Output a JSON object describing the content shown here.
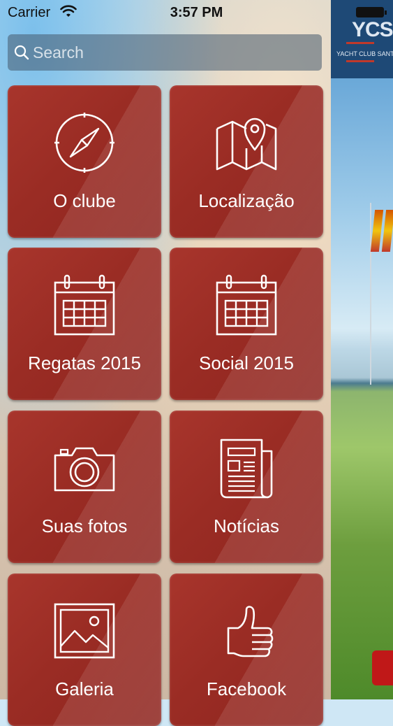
{
  "status_bar": {
    "carrier": "Carrier",
    "time": "3:57 PM"
  },
  "search": {
    "placeholder": "Search"
  },
  "side_panel": {
    "logo_text": "YCS",
    "logo_subtitle": "YACHT CLUB SANT"
  },
  "menu": {
    "items": [
      {
        "label": "O clube",
        "icon": "compass-icon"
      },
      {
        "label": "Localização",
        "icon": "map-pin-icon"
      },
      {
        "label": "Regatas 2015",
        "icon": "calendar-icon"
      },
      {
        "label": "Social 2015",
        "icon": "calendar-icon"
      },
      {
        "label": "Suas fotos",
        "icon": "camera-icon"
      },
      {
        "label": "Notícias",
        "icon": "newspaper-icon"
      },
      {
        "label": "Galeria",
        "icon": "image-gallery-icon"
      },
      {
        "label": "Facebook",
        "icon": "thumbs-up-icon"
      }
    ]
  },
  "colors": {
    "tile_red": "#9a2c24",
    "side_blue": "#1e4976"
  }
}
